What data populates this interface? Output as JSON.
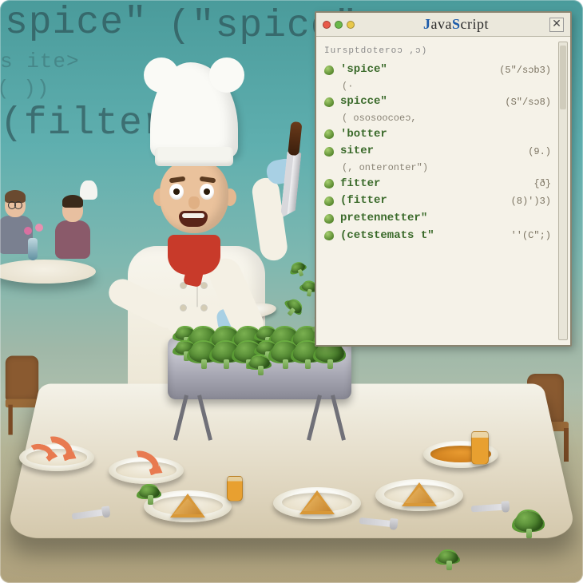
{
  "background_words": {
    "top_left": "spice\"",
    "top_mid": "(\"spice\"",
    "left_frag1": "s ite>",
    "left_frag2": "( ))",
    "left_filter": "(filter\""
  },
  "editor": {
    "title_plain": "JavaScript",
    "header_scribble": "Iursptdoteroɔ ,ɔ)",
    "lines": [
      {
        "keyword": "'spice\"",
        "sub": "(·",
        "rhs": "(5\"/sɔb3)"
      },
      {
        "keyword": "spicce\"",
        "sub": "( ososoocoeɔ,",
        "rhs": "(S\"/sɔ8)"
      },
      {
        "keyword": "'botter",
        "sub": "",
        "rhs": ""
      },
      {
        "keyword": "siter",
        "sub": "(, onteronter\")",
        "rhs": "(9.)"
      },
      {
        "keyword": "fitter",
        "sub": "",
        "rhs": "{ð}"
      },
      {
        "keyword": "(fitter",
        "sub": "",
        "rhs": "(8)')3)"
      },
      {
        "keyword": "pretennetter\"",
        "sub": "",
        "rhs": ""
      },
      {
        "keyword": "(cetstemats t\"",
        "sub": "",
        "rhs": "''(C\";)"
      }
    ]
  },
  "scene": {
    "broccoli_pile_count": 17,
    "falling_broccoli_count": 4
  }
}
